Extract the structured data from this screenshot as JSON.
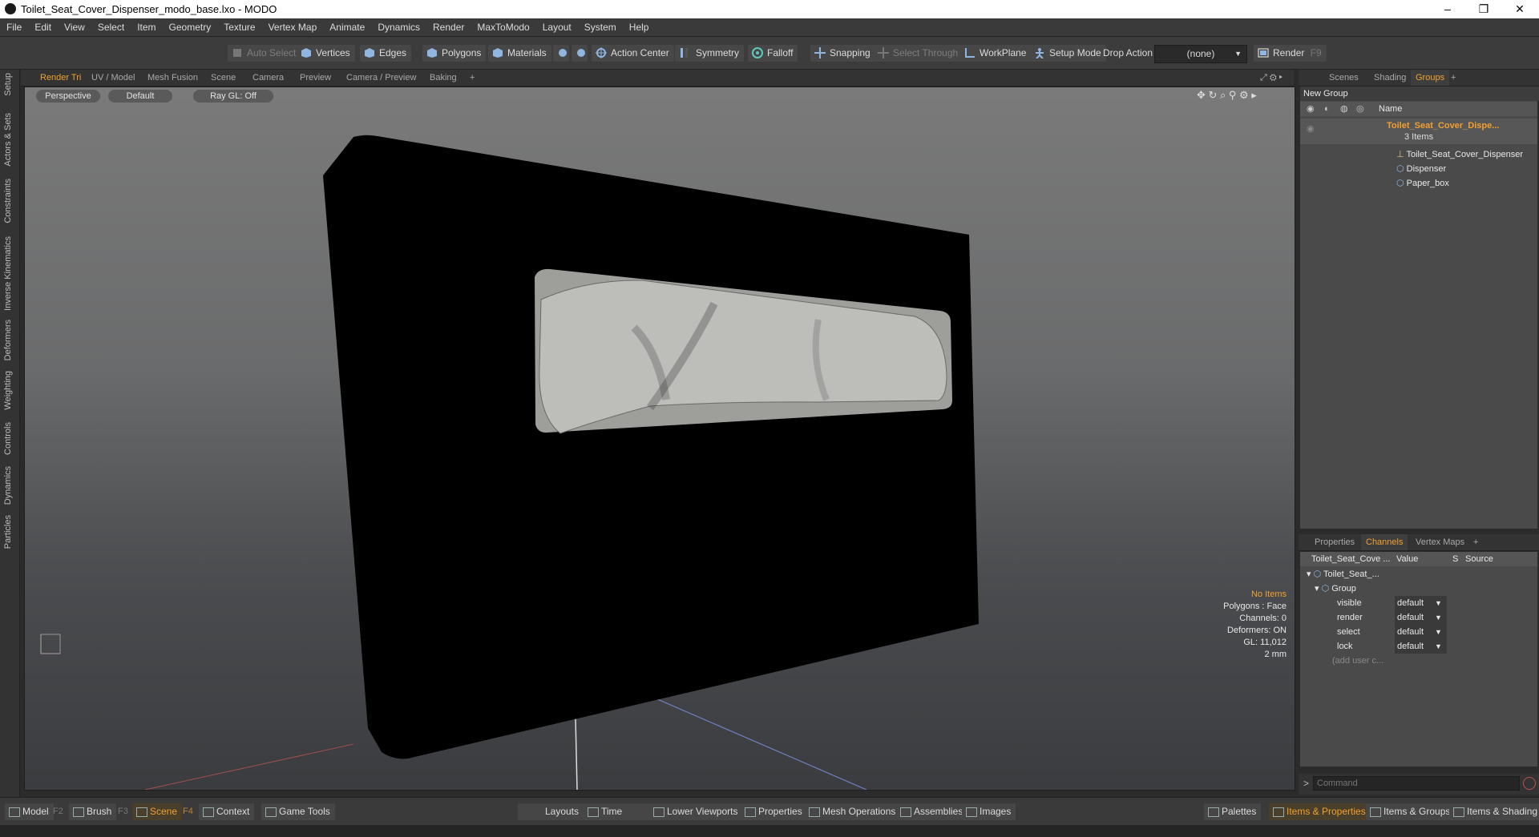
{
  "window": {
    "title": "Toilet_Seat_Cover_Dispenser_modo_base.lxo - MODO",
    "minimize": "–",
    "restore": "❐",
    "close": "✕"
  },
  "menu": [
    "File",
    "Edit",
    "View",
    "Select",
    "Item",
    "Geometry",
    "Texture",
    "Vertex Map",
    "Animate",
    "Dynamics",
    "Render",
    "MaxToModo",
    "Layout",
    "System",
    "Help"
  ],
  "toolbar": {
    "auto_select": "Auto Select",
    "vertices": "Vertices",
    "edges": "Edges",
    "polygons": "Polygons",
    "materials": "Materials",
    "action_center": "Action Center",
    "symmetry": "Symmetry",
    "falloff": "Falloff",
    "snapping": "Snapping",
    "select_through": "Select Through",
    "workplane": "WorkPlane",
    "setup_mode": "Setup Mode",
    "drop_action": "Drop Action",
    "drop_action_value": "(none)",
    "render": "Render",
    "render_key": "F9"
  },
  "left_tabs": [
    "Setup",
    "Actors & Sets",
    "Constraints",
    "Inverse Kinematics",
    "Deformers",
    "Weighting",
    "Controls",
    "Dynamics",
    "Particles"
  ],
  "viewport_tabs": [
    "Render Tri",
    "UV / Model",
    "Mesh Fusion",
    "Scene",
    "Camera",
    "Preview",
    "Camera / Preview",
    "Baking",
    "+"
  ],
  "viewport": {
    "projection": "Perspective",
    "shading": "Default",
    "raygl": "Ray GL: Off",
    "info": {
      "items": "No Items",
      "polygons": "Polygons : Face",
      "channels": "Channels: 0",
      "deformers": "Deformers: ON",
      "gl": "GL: 11,012",
      "unit": "2 mm"
    }
  },
  "right_tabs_top": [
    "Scenes",
    "Shading",
    "Groups",
    "+"
  ],
  "groups": {
    "new_group": "New Group",
    "name_header": "Name",
    "root": "Toilet_Seat_Cover_Dispe...",
    "root_count": "3 Items",
    "children": [
      "Toilet_Seat_Cover_Dispenser",
      "Dispenser",
      "Paper_box"
    ]
  },
  "right_tabs_bottom": [
    "Properties",
    "Channels",
    "Vertex Maps",
    "+"
  ],
  "channels": {
    "headers": [
      "Toilet_Seat_Cove ...",
      "Value",
      "S",
      "Source"
    ],
    "item": "Toilet_Seat_...",
    "group": "Group",
    "rows": [
      {
        "name": "visible",
        "value": "default"
      },
      {
        "name": "render",
        "value": "default"
      },
      {
        "name": "select",
        "value": "default"
      },
      {
        "name": "lock",
        "value": "default"
      }
    ],
    "add_user": "(add user c..."
  },
  "command": {
    "prompt": ">",
    "placeholder": "Command"
  },
  "bottom_bar": {
    "model": "Model",
    "model_key": "F2",
    "brush": "Brush",
    "brush_key": "F3",
    "scene": "Scene",
    "scene_key": "F4",
    "context": "Context",
    "game_tools": "Game Tools",
    "layouts": "Layouts",
    "time": "Time",
    "lower_viewports": "Lower Viewports",
    "properties": "Properties",
    "mesh_operations": "Mesh Operations",
    "assemblies": "Assemblies",
    "images": "Images",
    "palettes": "Palettes",
    "items_properties": "Items & Properties",
    "items_groups": "Items & Groups",
    "items_shading": "Items & Shading"
  },
  "colors": {
    "accent": "#f0a030",
    "root_item": "#f0a030"
  }
}
